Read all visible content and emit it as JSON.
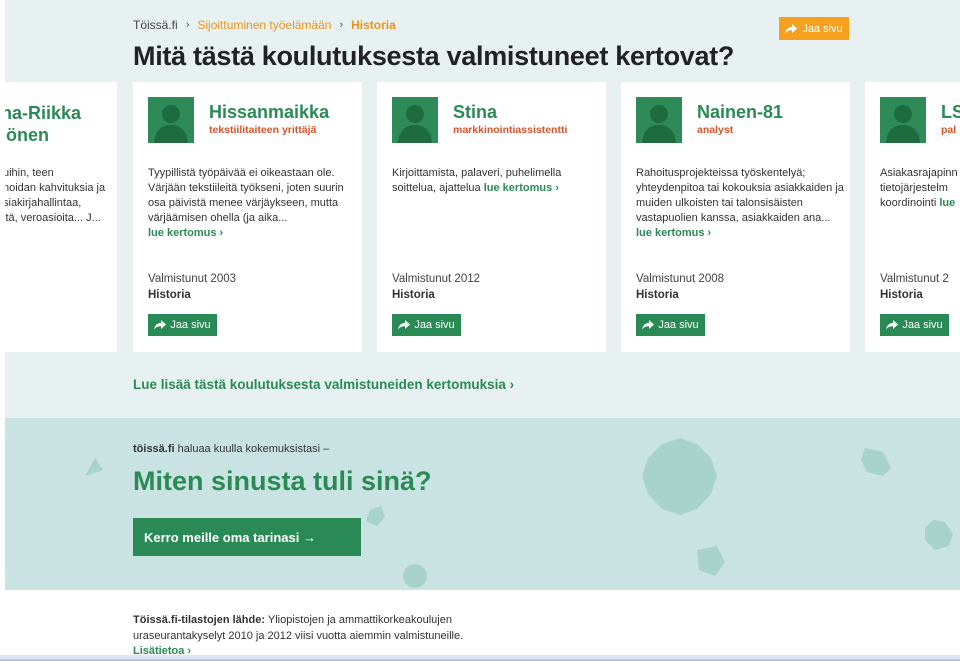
{
  "breadcrumb": {
    "home": "Töissä.fi",
    "section": "Sijoittuminen työelämään",
    "current": "Historia"
  },
  "share_label": "Jaa sivu",
  "page_title": "Mitä tästä koulutuksesta valmistuneet kertovat?",
  "partial_left": {
    "name_line1": "na-Riikka",
    "name_line2": "iönen",
    "desc_line1": "uihin, teen",
    "desc_line2": "noidan kahvituksia ja",
    "desc_line3": "siakirjahallintaa,",
    "desc_line4": "itä, veroasioita... J..."
  },
  "cards": [
    {
      "name": "Hissanmaikka",
      "role": "tekstiilitaiteen yrittäjä",
      "desc": "Tyypillistä työpäivää ei oikeastaan ole. Värjään tekstiileitä työkseni, joten suurin osa päivistä menee värjäykseen, mutta värjäämisen ohella (ja aika...",
      "more": "lue kertomus ›",
      "grad": "Valmistunut 2003",
      "subject": "Historia"
    },
    {
      "name": "Stina",
      "role": "markkinointiassistentti",
      "desc": "Kirjoittamista, palaveri, puhelimella soittelua, ajattelua",
      "more": "lue kertomus ›",
      "grad": "Valmistunut 2012",
      "subject": "Historia"
    },
    {
      "name": "Nainen-81",
      "role": "analyst",
      "desc": "Rahoitusprojekteissa työskentelyä; yhteydenpitoa tai kokouksia asiakkaiden ja muiden ulkoisten tai talonsisäisten vastapuolien kanssa, asiakkaiden ana...",
      "more": "lue kertomus ›",
      "grad": "Valmistunut 2008",
      "subject": "Historia"
    },
    {
      "name": "LS",
      "role": "pal",
      "desc": "Asiakasrajapinn tietojärjestelm koordinointi",
      "more": "lue",
      "grad": "Valmistunut 2",
      "subject": "Historia"
    }
  ],
  "more_stories": "Lue lisää tästä koulutuksesta valmistuneiden kertomuksia ›",
  "feedback": {
    "brand": "töissä.fi",
    "intro": "haluaa kuulla kokemuksistasi –",
    "heading": "Miten sinusta tuli sinä?",
    "cta": "Kerro meille oma tarinasi →"
  },
  "source": {
    "label": "Töissä.fi-tilastojen lähde:",
    "text": "Yliopistojen ja ammattikorkeakoulujen uraseurantakyselyt 2010 ja 2012 viisi vuotta aiemmin valmistuneille.",
    "more": "Lisätietoa ›"
  },
  "colors": {
    "green": "#2a8a55",
    "orange": "#f5a11d",
    "role_red": "#d9542a",
    "band": "#e8f1f2",
    "feedback_bg": "#c9e3e2"
  },
  "icons": {
    "share": "share-arrow-icon",
    "avatar": "person-silhouette-icon"
  }
}
